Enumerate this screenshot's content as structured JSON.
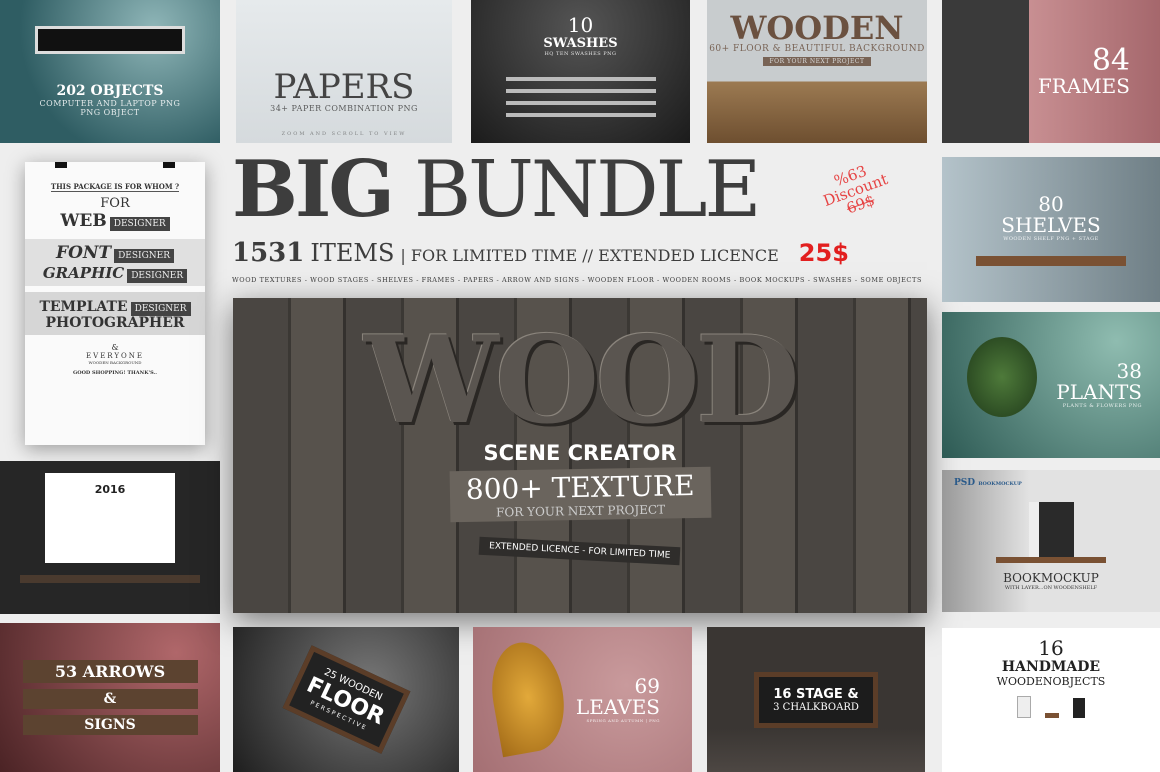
{
  "header": {
    "title_bold": "BIG",
    "title_light": "BUNDLE",
    "discount": "%63",
    "discount_label": "Discount",
    "old_price": "69$",
    "count": "1531",
    "items_label": "ITEMS",
    "tagline": "| FOR LIMITED TIME // EXTENDED LICENCE",
    "price": "25$",
    "categories": "WOOD TEXTURES - WOOD STAGES - SHELVES - FRAMES - PAPERS - ARROW AND SIGNS - WOODEN FLOOR - WOODEN ROOMS - BOOK MOCKUPS - SWASHES - SOME OBJECTS"
  },
  "colors": {
    "accent_red": "#e21f1f",
    "discount_red": "#e64545",
    "text_dark": "#3d3d3d"
  },
  "tiles": {
    "objects": {
      "title": "202 OBJECTS",
      "sub": "COMPUTER AND LAPTOP PNG",
      "sub2": "PNG OBJECT"
    },
    "papers": {
      "title": "PAPERS",
      "sub": "34+ PAPER COMBINATION PNG"
    },
    "swashes": {
      "num": "10",
      "title": "SWASHES",
      "sub": "HQ TEN SWASHES PNG"
    },
    "wooden": {
      "title": "WOODEN",
      "sub": "60+ FLOOR & BEAUTIFUL BACKGROUND",
      "tag": "FOR YOUR NEXT PROJECT"
    },
    "frames": {
      "num": "84",
      "title": "FRAMES"
    },
    "shelves": {
      "num": "80",
      "title": "SHELVES",
      "sub": "WOODEN SHELF PNG + STAGE"
    },
    "plants": {
      "num": "38",
      "title": "PLANTS",
      "sub": "PLANTS & FLOWERS PNG"
    },
    "book": {
      "psd": "PSD",
      "psd_label": "BOOKMOCKUP",
      "title": "BOOKMOCKUP",
      "sub": "WITH LAYER...ON WOODENSHELF"
    },
    "calendar": {
      "year": "2016"
    },
    "arrows": {
      "line1": "53 ARROWS",
      "line2": "&",
      "line3": "SIGNS"
    },
    "floor": {
      "line1": "25 WOODEN",
      "line2": "FLOOR",
      "line3": "PERSPECTIVE"
    },
    "leaves": {
      "num": "69",
      "title": "LEAVES",
      "sub": "SPRING AND AUTUMN | PNG"
    },
    "stage": {
      "line1": "16 STAGE &",
      "line2": "3 CHALKBOARD"
    },
    "handmade": {
      "num": "16",
      "title": "HANDMADE",
      "sub": "WOODENOBJECTS"
    }
  },
  "poster": {
    "question": "THIS PACKAGE IS FOR WHOM ?",
    "for": "FOR",
    "web": "WEB",
    "font": "FONT",
    "graphic": "GRAPHIC",
    "template": "TEMPLATE",
    "designer": "DESIGNER",
    "photographer": "PHOTOGRAPHER",
    "amp": "&",
    "everyone": "EVERYONE",
    "wb": "WOODEN BACKGROUND",
    "thanks": "GOOD SHOPPING! THANK'S.."
  },
  "hero": {
    "wood": "WOOD",
    "scene": "SCENE CREATOR",
    "count": "800+",
    "texture": "TEXTURE",
    "next": "FOR YOUR NEXT PROJECT",
    "ext": "EXTENDED LICENCE - FOR LIMITED TIME"
  },
  "footer_text": "ZOOM AND SCROLL TO VIEW"
}
